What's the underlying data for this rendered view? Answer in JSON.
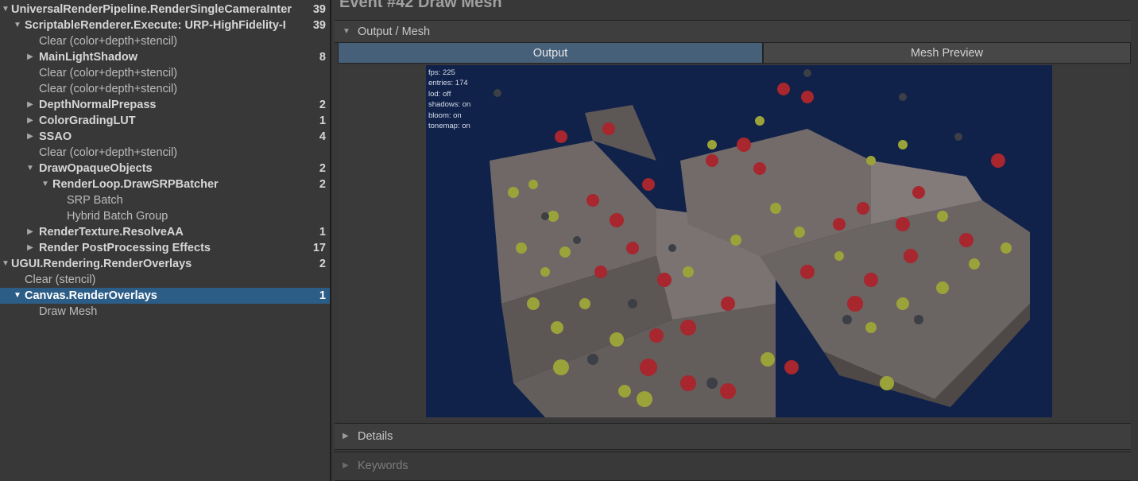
{
  "tree": {
    "rows": [
      {
        "label": "UniversalRenderPipeline.RenderSingleCameraInter",
        "count": "39"
      },
      {
        "label": "ScriptableRenderer.Execute: URP-HighFidelity-I",
        "count": "39"
      },
      {
        "label": "Clear (color+depth+stencil)",
        "count": ""
      },
      {
        "label": "MainLightShadow",
        "count": "8"
      },
      {
        "label": "Clear (color+depth+stencil)",
        "count": ""
      },
      {
        "label": "Clear (color+depth+stencil)",
        "count": ""
      },
      {
        "label": "DepthNormalPrepass",
        "count": "2"
      },
      {
        "label": "ColorGradingLUT",
        "count": "1"
      },
      {
        "label": "SSAO",
        "count": "4"
      },
      {
        "label": "Clear (color+depth+stencil)",
        "count": ""
      },
      {
        "label": "DrawOpaqueObjects",
        "count": "2"
      },
      {
        "label": "RenderLoop.DrawSRPBatcher",
        "count": "2"
      },
      {
        "label": "SRP Batch",
        "count": ""
      },
      {
        "label": "Hybrid Batch Group",
        "count": ""
      },
      {
        "label": "RenderTexture.ResolveAA",
        "count": "1"
      },
      {
        "label": "Render PostProcessing Effects",
        "count": "17"
      },
      {
        "label": "UGUI.Rendering.RenderOverlays",
        "count": "2"
      },
      {
        "label": "Clear (stencil)",
        "count": ""
      },
      {
        "label": "Canvas.RenderOverlays",
        "count": "1"
      },
      {
        "label": "Draw Mesh",
        "count": ""
      }
    ]
  },
  "event_title": "Event #42 Draw Mesh",
  "sections": {
    "output_mesh": "Output / Mesh",
    "details": "Details",
    "keywords": "Keywords"
  },
  "tabs": {
    "output": "Output",
    "mesh_preview": "Mesh Preview"
  },
  "preview": {
    "stats": [
      "fps: 225",
      "entries: 174",
      "lod: off",
      "shadows: on",
      "bloom: on",
      "tonemap: on"
    ]
  },
  "colors": {
    "selection": "#2c5d87",
    "viewport_bg": "#0f2046",
    "active_tab": "#46607a"
  }
}
